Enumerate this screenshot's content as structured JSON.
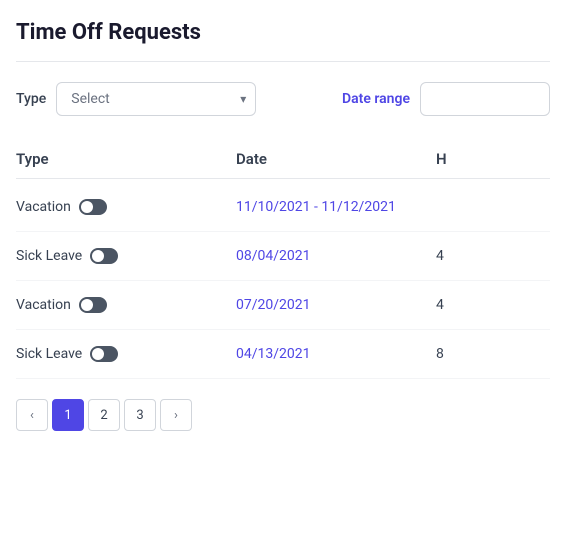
{
  "page": {
    "title": "Time Off Requests"
  },
  "filters": {
    "type_label": "Type",
    "type_placeholder": "Select",
    "date_range_label": "Date range",
    "date_range_placeholder": ""
  },
  "table": {
    "headers": [
      {
        "id": "type",
        "label": "Type"
      },
      {
        "id": "date",
        "label": "Date"
      },
      {
        "id": "hours",
        "label": "H"
      }
    ],
    "rows": [
      {
        "id": 1,
        "type": "Vacation",
        "date": "11/10/2021 - 11/12/2021",
        "hours": ""
      },
      {
        "id": 2,
        "type": "Sick Leave",
        "date": "08/04/2021",
        "hours": "4"
      },
      {
        "id": 3,
        "type": "Vacation",
        "date": "07/20/2021",
        "hours": "4"
      },
      {
        "id": 4,
        "type": "Sick Leave",
        "date": "04/13/2021",
        "hours": "8"
      }
    ]
  },
  "pagination": {
    "prev": "‹",
    "next": "›",
    "pages": [
      "1",
      "2",
      "3"
    ]
  }
}
